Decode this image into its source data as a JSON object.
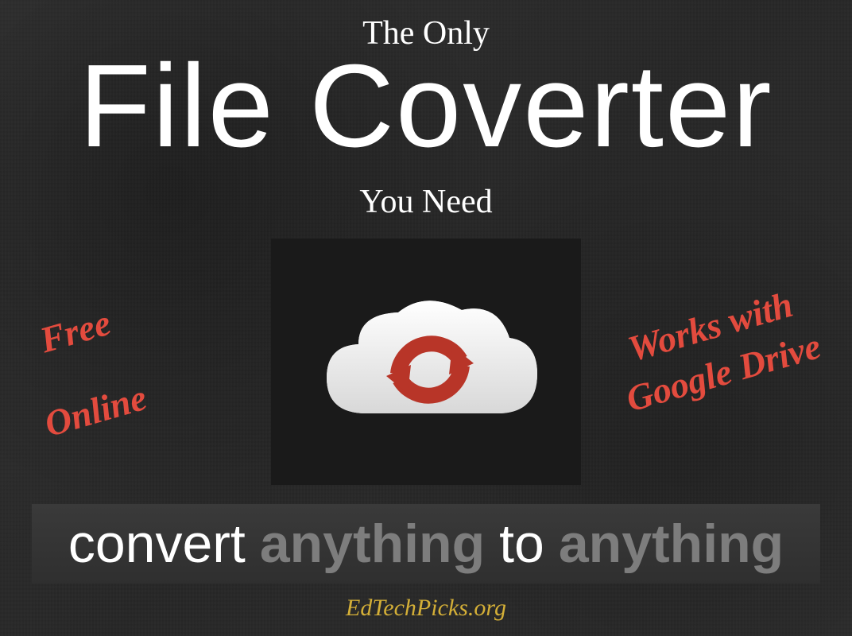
{
  "eyebrow": "The Only",
  "title": "File Coverter",
  "subtext": "You Need",
  "features": {
    "left1": "Free",
    "left2": "Online",
    "right": "Works with Google Drive"
  },
  "tagline": {
    "word1": "convert",
    "word2": "anything",
    "word3": "to",
    "word4": "anything"
  },
  "footer_url": "EdTechPicks.org",
  "colors": {
    "accent_red": "#e34b3e",
    "accent_gold": "#d4af37",
    "cloud_fill": "#f0f0f0",
    "sync_red": "#c13c2e"
  }
}
